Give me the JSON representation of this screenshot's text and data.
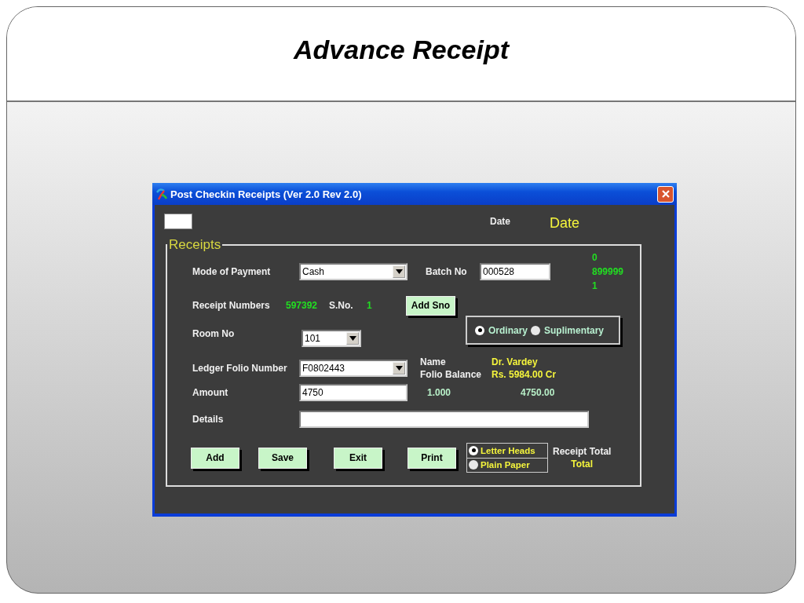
{
  "slide": {
    "title": "Advance Receipt"
  },
  "window": {
    "title": "Post Checkin Receipts (Ver 2.0 Rev 2.0)"
  },
  "date": {
    "label": "Date",
    "value": "Date"
  },
  "receipts": {
    "legend": "Receipts",
    "mode_of_payment": {
      "label": "Mode of Payment",
      "value": "Cash"
    },
    "batch_no": {
      "label": "Batch No",
      "value": "000528"
    },
    "counter_values": [
      "0",
      "899999",
      "1"
    ],
    "receipt_numbers": {
      "label": "Receipt Numbers",
      "value": "597392"
    },
    "sno": {
      "label": "S.No.",
      "value": "1"
    },
    "add_sno_button": "Add Sno",
    "room_no": {
      "label": "Room No",
      "value": "101"
    },
    "bill_type": [
      {
        "label": "Ordinary",
        "selected": true
      },
      {
        "label": "Suplimentary",
        "selected": false
      }
    ],
    "ledger_folio_number": {
      "label": "Ledger Folio Number",
      "value": "F0802443"
    },
    "name": {
      "label": "Name",
      "value": "Dr. Vardey"
    },
    "folio_balance": {
      "label": "Folio Balance",
      "value": "Rs. 5984.00 Cr"
    },
    "amount": {
      "label": "Amount",
      "value": "4750"
    },
    "rate": "1.000",
    "computed_amount": "4750.00",
    "details": {
      "label": "Details"
    },
    "buttons": [
      "Add",
      "Save",
      "Exit",
      "Print"
    ],
    "print_mode": [
      {
        "label": "Letter Heads",
        "selected": true
      },
      {
        "label": "Plain Paper",
        "selected": false
      }
    ],
    "receipt_total": {
      "label": "Receipt Total",
      "value": "Total"
    }
  }
}
